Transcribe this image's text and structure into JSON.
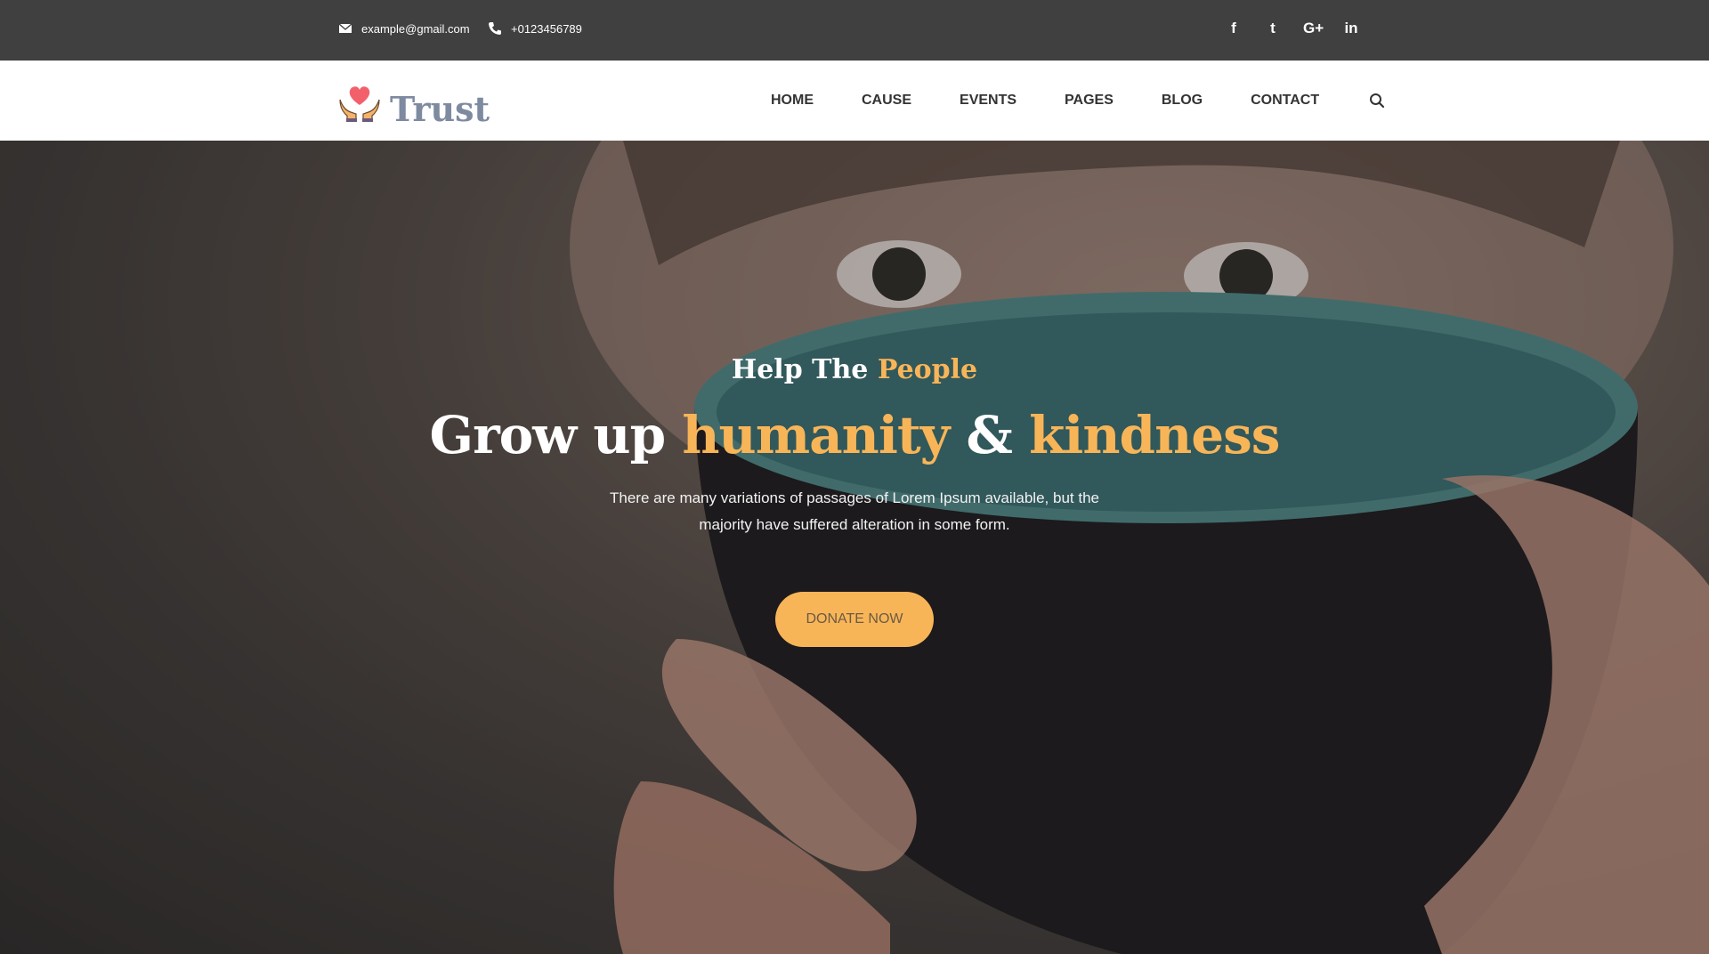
{
  "topbar": {
    "email": "example@gmail.com",
    "phone": "+0123456789",
    "social": [
      {
        "name": "facebook-icon",
        "glyph": "f"
      },
      {
        "name": "twitter-icon",
        "glyph": "t"
      },
      {
        "name": "google-plus-icon",
        "glyph": "G+"
      },
      {
        "name": "linkedin-icon",
        "glyph": "in"
      }
    ]
  },
  "navbar": {
    "logo_text": "Trust",
    "menu": [
      "HOME",
      "CAUSE",
      "EVENTS",
      "PAGES",
      "BLOG",
      "CONTACT"
    ]
  },
  "hero": {
    "kicker_plain": "Help The",
    "kicker_highlight": "People",
    "headline_part1": "Grow up",
    "headline_highlight1": "humanity",
    "headline_amp": "&",
    "headline_highlight2": "kindness",
    "description": "There are many variations of passages of Lorem Ipsum available, but the majority have suffered alteration in some form.",
    "cta_label": "DONATE NOW"
  },
  "colors": {
    "accent": "#f8b558",
    "topbar_bg": "#404040",
    "navbar_bg": "#ffffff"
  }
}
